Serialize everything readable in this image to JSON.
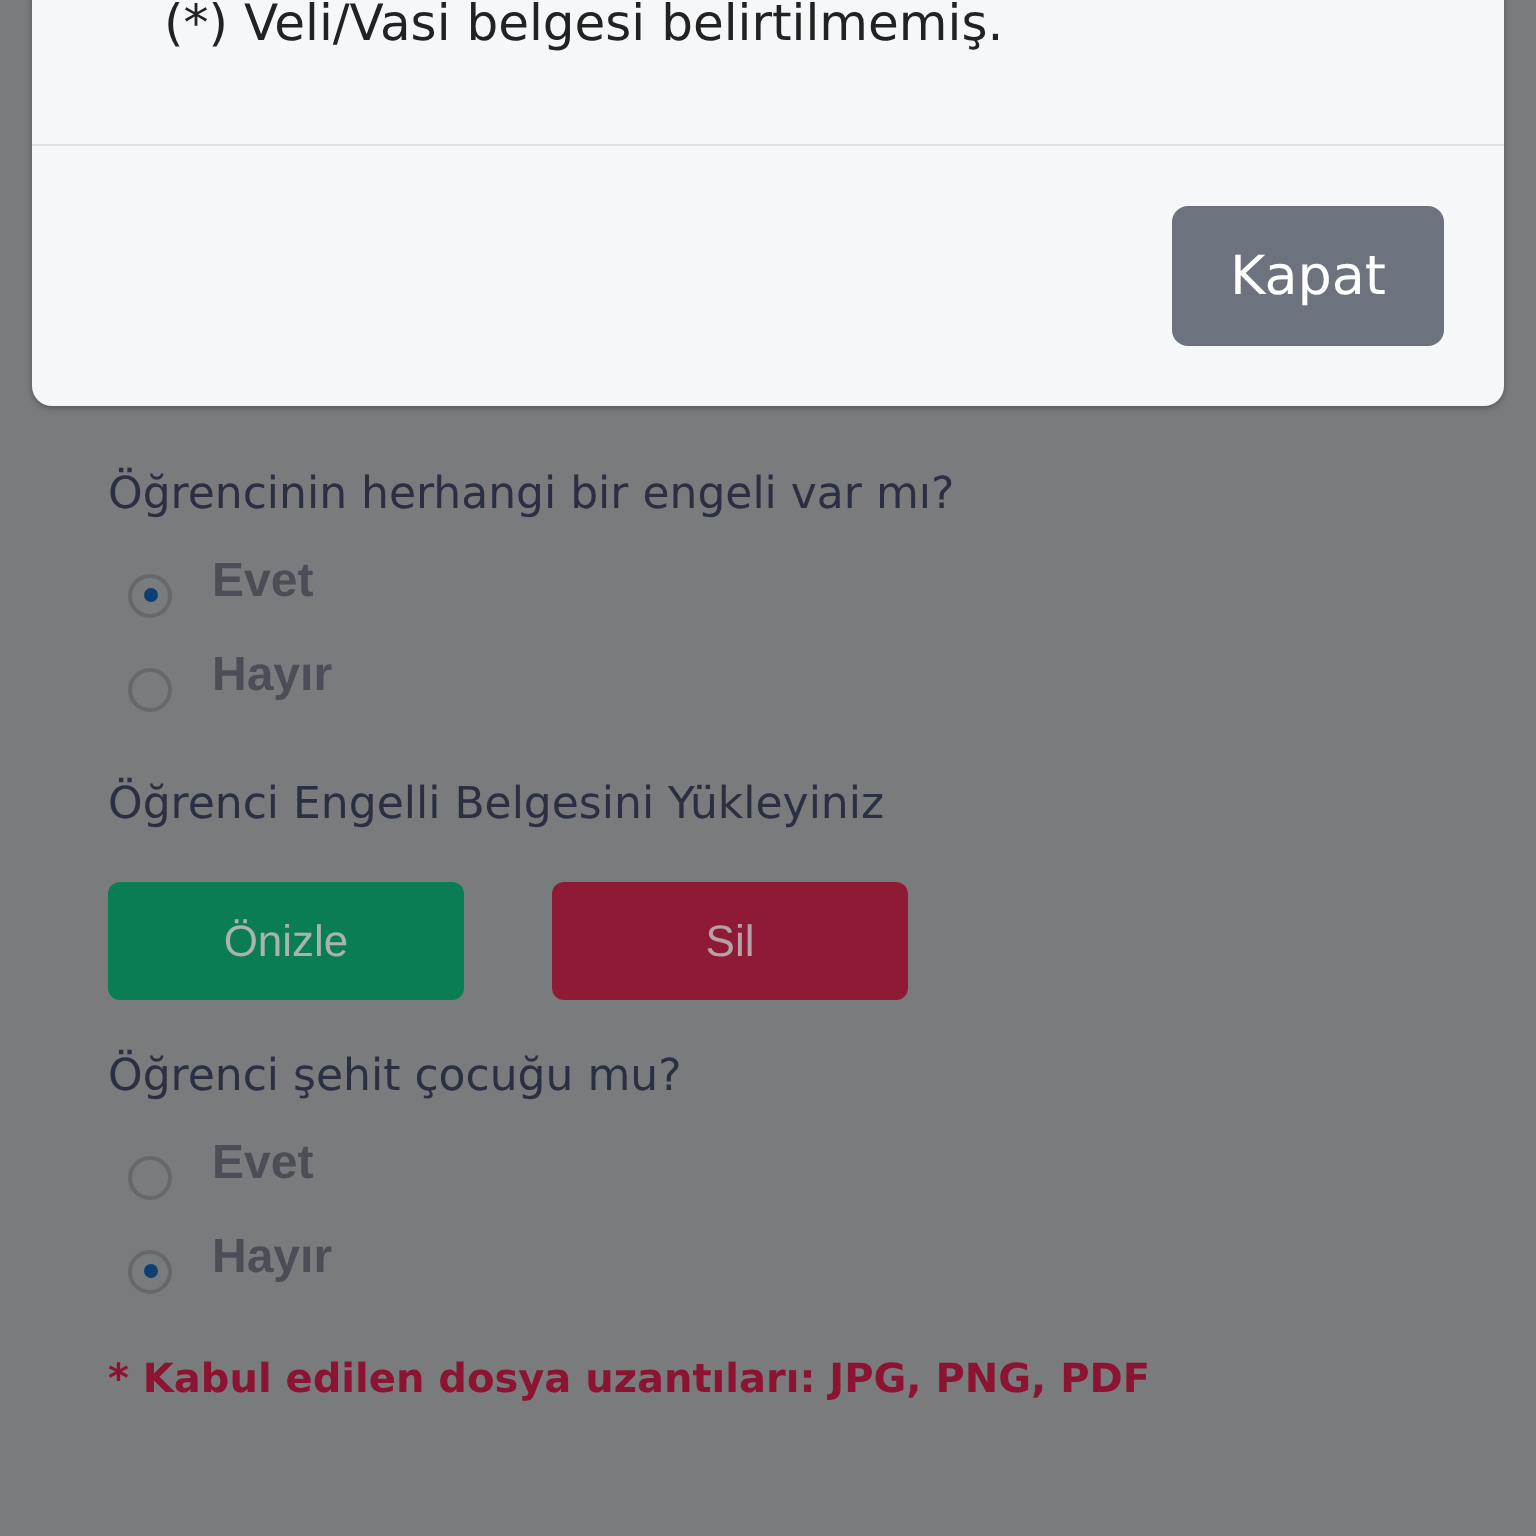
{
  "modal": {
    "message": "(*) Veli/Vasi belgesi belirtilmemiş.",
    "close_button": "Kapat"
  },
  "sections": [
    {
      "kind": "radio",
      "question": "Öğrencinin herhangi bir engeli var mı?",
      "options": [
        {
          "label": "Evet",
          "selected": true
        },
        {
          "label": "Hayır",
          "selected": false
        }
      ]
    },
    {
      "kind": "upload",
      "question": "Öğrenci Engelli Belgesini Yükleyiniz",
      "buttons": [
        {
          "label": "Önizle",
          "kind": "preview"
        },
        {
          "label": "Sil",
          "kind": "delete"
        }
      ]
    },
    {
      "kind": "radio",
      "question": "Öğrenci şehit çocuğu mu?",
      "options": [
        {
          "label": "Evet",
          "selected": false
        },
        {
          "label": "Hayır",
          "selected": true
        }
      ]
    }
  ],
  "note": "* Kabul edilen dosya uzantıları: JPG, PNG, PDF"
}
